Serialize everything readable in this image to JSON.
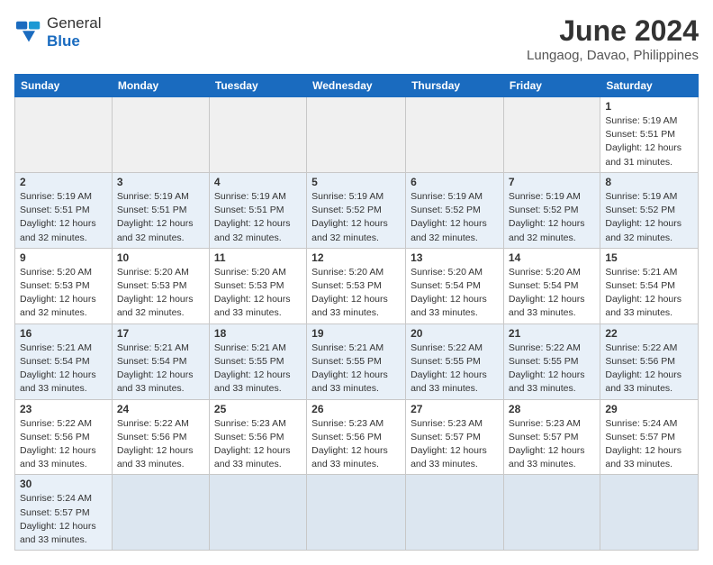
{
  "header": {
    "logo_general": "General",
    "logo_blue": "Blue",
    "title": "June 2024",
    "subtitle": "Lungaog, Davao, Philippines"
  },
  "days_of_week": [
    "Sunday",
    "Monday",
    "Tuesday",
    "Wednesday",
    "Thursday",
    "Friday",
    "Saturday"
  ],
  "weeks": [
    {
      "alt": false,
      "days": [
        {
          "num": "",
          "info": "",
          "empty": true
        },
        {
          "num": "",
          "info": "",
          "empty": true
        },
        {
          "num": "",
          "info": "",
          "empty": true
        },
        {
          "num": "",
          "info": "",
          "empty": true
        },
        {
          "num": "",
          "info": "",
          "empty": true
        },
        {
          "num": "",
          "info": "",
          "empty": true
        },
        {
          "num": "1",
          "info": "Sunrise: 5:19 AM\nSunset: 5:51 PM\nDaylight: 12 hours\nand 31 minutes.",
          "empty": false
        }
      ]
    },
    {
      "alt": true,
      "days": [
        {
          "num": "2",
          "info": "Sunrise: 5:19 AM\nSunset: 5:51 PM\nDaylight: 12 hours\nand 32 minutes.",
          "empty": false
        },
        {
          "num": "3",
          "info": "Sunrise: 5:19 AM\nSunset: 5:51 PM\nDaylight: 12 hours\nand 32 minutes.",
          "empty": false
        },
        {
          "num": "4",
          "info": "Sunrise: 5:19 AM\nSunset: 5:51 PM\nDaylight: 12 hours\nand 32 minutes.",
          "empty": false
        },
        {
          "num": "5",
          "info": "Sunrise: 5:19 AM\nSunset: 5:52 PM\nDaylight: 12 hours\nand 32 minutes.",
          "empty": false
        },
        {
          "num": "6",
          "info": "Sunrise: 5:19 AM\nSunset: 5:52 PM\nDaylight: 12 hours\nand 32 minutes.",
          "empty": false
        },
        {
          "num": "7",
          "info": "Sunrise: 5:19 AM\nSunset: 5:52 PM\nDaylight: 12 hours\nand 32 minutes.",
          "empty": false
        },
        {
          "num": "8",
          "info": "Sunrise: 5:19 AM\nSunset: 5:52 PM\nDaylight: 12 hours\nand 32 minutes.",
          "empty": false
        }
      ]
    },
    {
      "alt": false,
      "days": [
        {
          "num": "9",
          "info": "Sunrise: 5:20 AM\nSunset: 5:53 PM\nDaylight: 12 hours\nand 32 minutes.",
          "empty": false
        },
        {
          "num": "10",
          "info": "Sunrise: 5:20 AM\nSunset: 5:53 PM\nDaylight: 12 hours\nand 32 minutes.",
          "empty": false
        },
        {
          "num": "11",
          "info": "Sunrise: 5:20 AM\nSunset: 5:53 PM\nDaylight: 12 hours\nand 33 minutes.",
          "empty": false
        },
        {
          "num": "12",
          "info": "Sunrise: 5:20 AM\nSunset: 5:53 PM\nDaylight: 12 hours\nand 33 minutes.",
          "empty": false
        },
        {
          "num": "13",
          "info": "Sunrise: 5:20 AM\nSunset: 5:54 PM\nDaylight: 12 hours\nand 33 minutes.",
          "empty": false
        },
        {
          "num": "14",
          "info": "Sunrise: 5:20 AM\nSunset: 5:54 PM\nDaylight: 12 hours\nand 33 minutes.",
          "empty": false
        },
        {
          "num": "15",
          "info": "Sunrise: 5:21 AM\nSunset: 5:54 PM\nDaylight: 12 hours\nand 33 minutes.",
          "empty": false
        }
      ]
    },
    {
      "alt": true,
      "days": [
        {
          "num": "16",
          "info": "Sunrise: 5:21 AM\nSunset: 5:54 PM\nDaylight: 12 hours\nand 33 minutes.",
          "empty": false
        },
        {
          "num": "17",
          "info": "Sunrise: 5:21 AM\nSunset: 5:54 PM\nDaylight: 12 hours\nand 33 minutes.",
          "empty": false
        },
        {
          "num": "18",
          "info": "Sunrise: 5:21 AM\nSunset: 5:55 PM\nDaylight: 12 hours\nand 33 minutes.",
          "empty": false
        },
        {
          "num": "19",
          "info": "Sunrise: 5:21 AM\nSunset: 5:55 PM\nDaylight: 12 hours\nand 33 minutes.",
          "empty": false
        },
        {
          "num": "20",
          "info": "Sunrise: 5:22 AM\nSunset: 5:55 PM\nDaylight: 12 hours\nand 33 minutes.",
          "empty": false
        },
        {
          "num": "21",
          "info": "Sunrise: 5:22 AM\nSunset: 5:55 PM\nDaylight: 12 hours\nand 33 minutes.",
          "empty": false
        },
        {
          "num": "22",
          "info": "Sunrise: 5:22 AM\nSunset: 5:56 PM\nDaylight: 12 hours\nand 33 minutes.",
          "empty": false
        }
      ]
    },
    {
      "alt": false,
      "days": [
        {
          "num": "23",
          "info": "Sunrise: 5:22 AM\nSunset: 5:56 PM\nDaylight: 12 hours\nand 33 minutes.",
          "empty": false
        },
        {
          "num": "24",
          "info": "Sunrise: 5:22 AM\nSunset: 5:56 PM\nDaylight: 12 hours\nand 33 minutes.",
          "empty": false
        },
        {
          "num": "25",
          "info": "Sunrise: 5:23 AM\nSunset: 5:56 PM\nDaylight: 12 hours\nand 33 minutes.",
          "empty": false
        },
        {
          "num": "26",
          "info": "Sunrise: 5:23 AM\nSunset: 5:56 PM\nDaylight: 12 hours\nand 33 minutes.",
          "empty": false
        },
        {
          "num": "27",
          "info": "Sunrise: 5:23 AM\nSunset: 5:57 PM\nDaylight: 12 hours\nand 33 minutes.",
          "empty": false
        },
        {
          "num": "28",
          "info": "Sunrise: 5:23 AM\nSunset: 5:57 PM\nDaylight: 12 hours\nand 33 minutes.",
          "empty": false
        },
        {
          "num": "29",
          "info": "Sunrise: 5:24 AM\nSunset: 5:57 PM\nDaylight: 12 hours\nand 33 minutes.",
          "empty": false
        }
      ]
    },
    {
      "alt": true,
      "days": [
        {
          "num": "30",
          "info": "Sunrise: 5:24 AM\nSunset: 5:57 PM\nDaylight: 12 hours\nand 33 minutes.",
          "empty": false
        },
        {
          "num": "",
          "info": "",
          "empty": true
        },
        {
          "num": "",
          "info": "",
          "empty": true
        },
        {
          "num": "",
          "info": "",
          "empty": true
        },
        {
          "num": "",
          "info": "",
          "empty": true
        },
        {
          "num": "",
          "info": "",
          "empty": true
        },
        {
          "num": "",
          "info": "",
          "empty": true
        }
      ]
    }
  ]
}
